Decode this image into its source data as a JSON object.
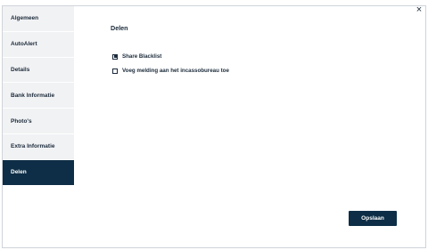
{
  "close_icon": "×",
  "sidebar": {
    "items": [
      {
        "label": "Algemeen",
        "active": false
      },
      {
        "label": "AutoAlert",
        "active": false
      },
      {
        "label": "Details",
        "active": false
      },
      {
        "label": "Bank Informatie",
        "active": false
      },
      {
        "label": "Photo's",
        "active": false
      },
      {
        "label": "Extra Informatie",
        "active": false
      },
      {
        "label": "Delen",
        "active": true
      }
    ]
  },
  "main": {
    "title": "Delen",
    "options": [
      {
        "label": "Share Blacklist",
        "checked": true
      },
      {
        "label": "Voeg melding aan het incassobureau toe",
        "checked": false
      }
    ],
    "save_label": "Opslaan"
  },
  "colors": {
    "accent": "#0d2e46",
    "sidebar_bg": "#f1f2f4",
    "text": "#1b2a3a"
  }
}
